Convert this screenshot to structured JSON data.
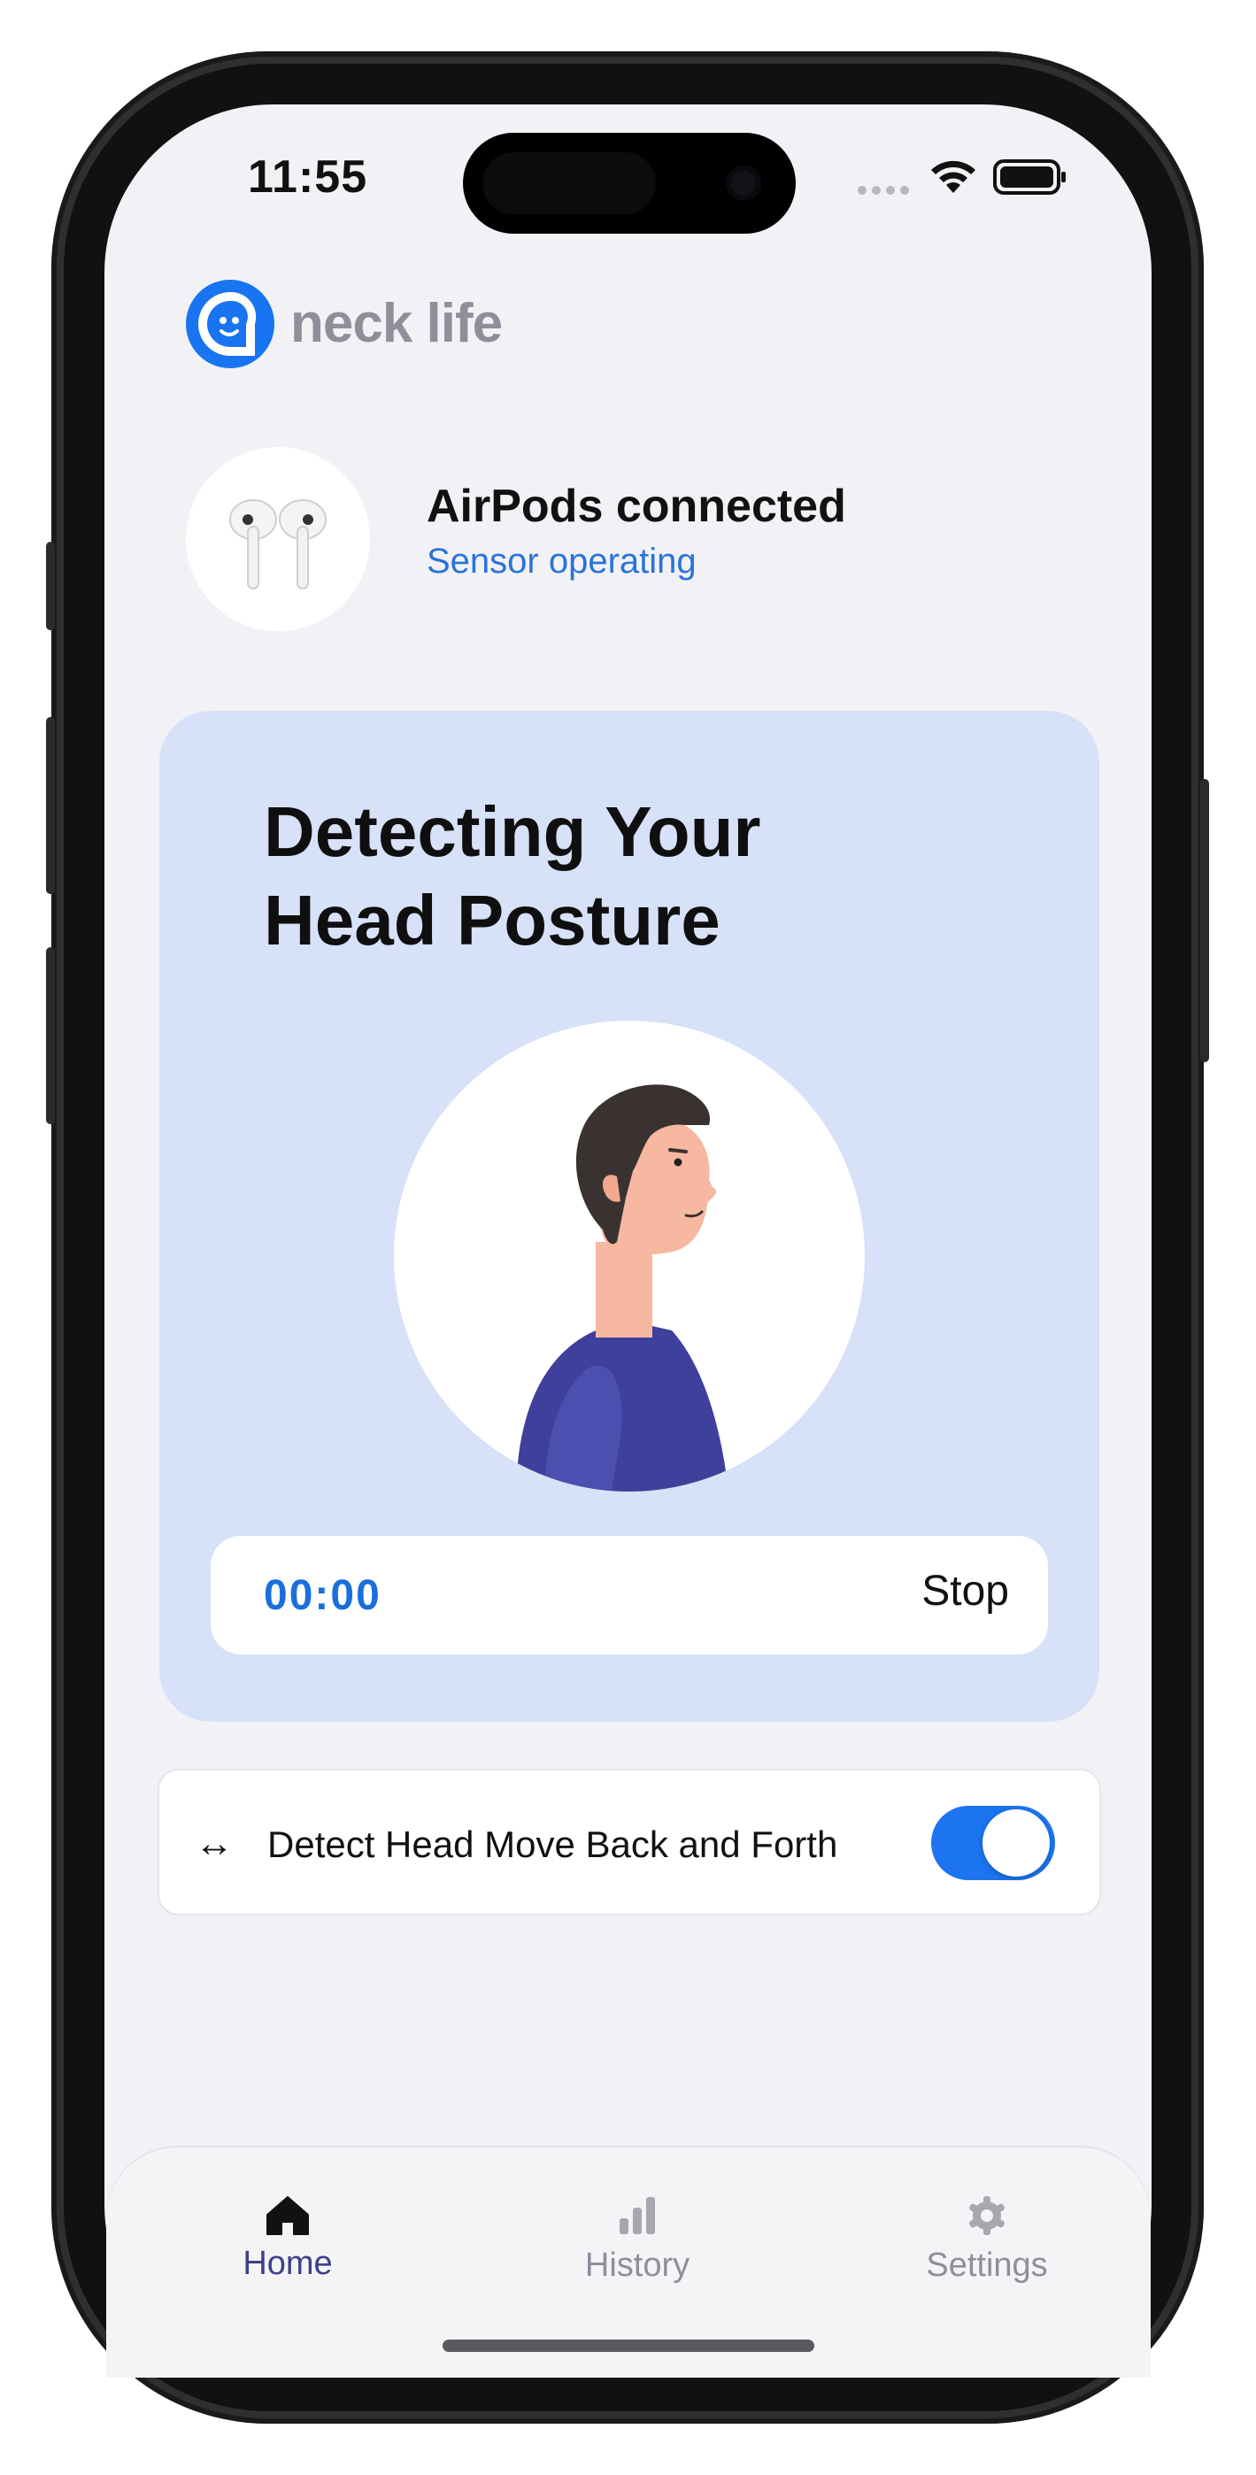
{
  "status_bar": {
    "time": "11:55"
  },
  "app": {
    "logo_text": "neck life"
  },
  "connection": {
    "title": "AirPods connected",
    "subtitle": "Sensor operating"
  },
  "detection_card": {
    "heading": "Detecting Your\nHead Posture",
    "timer": "00:00",
    "stop_label": "Stop"
  },
  "toggle_row": {
    "icon": "↔",
    "label": "Detect Head Move Back and Forth",
    "enabled": true
  },
  "tabs": [
    {
      "label": "Home",
      "icon": "home-icon",
      "active": true
    },
    {
      "label": "History",
      "icon": "bar-chart-icon",
      "active": false
    },
    {
      "label": "Settings",
      "icon": "gear-icon",
      "active": false
    }
  ],
  "colors": {
    "accent": "#1c74f0",
    "card_bg": "#d7e1f8",
    "screen_bg": "#f2f2f6",
    "active_tab": "#3d3f8c",
    "inactive_tab": "#8e8f9a"
  }
}
